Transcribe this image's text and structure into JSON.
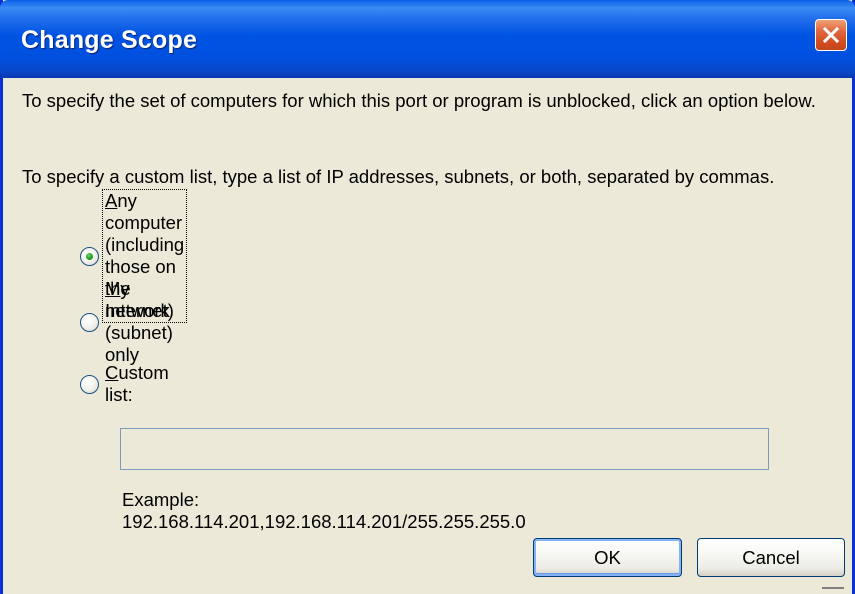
{
  "window": {
    "title": "Change Scope",
    "close_icon": "close-icon"
  },
  "instructions": {
    "line1": "To specify the set of computers for which this port or program is unblocked, click an option below.",
    "line2": "To specify a custom list, type a list of IP addresses, subnets, or both, separated by commas."
  },
  "options": [
    {
      "label_prefix": "",
      "label_mnemonic": "A",
      "label_rest": "ny computer (including those on the Internet)",
      "selected": true
    },
    {
      "label_prefix": "",
      "label_mnemonic": "M",
      "label_rest": "y network (subnet) only",
      "selected": false
    },
    {
      "label_prefix": "",
      "label_mnemonic": "C",
      "label_rest": "ustom list:",
      "selected": false
    }
  ],
  "custom_list": {
    "value": "",
    "example": "Example: 192.168.114.201,192.168.114.201/255.255.255.0"
  },
  "buttons": {
    "ok": "OK",
    "cancel": "Cancel"
  },
  "colors": {
    "titlebar": "#0054e3",
    "dialog_bg": "#ece9d8",
    "close_button": "#d24c1f",
    "radio_dot": "#21a121"
  }
}
